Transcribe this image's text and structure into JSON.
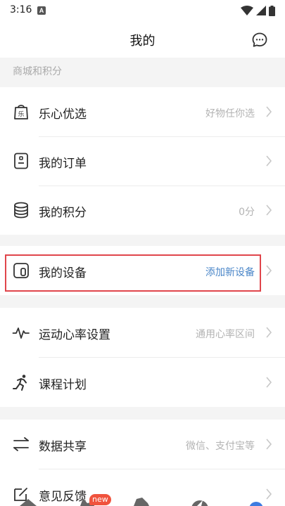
{
  "status": {
    "time": "3:16",
    "a_label": "A"
  },
  "header": {
    "title": "我的"
  },
  "section1": {
    "label": "商城和积分"
  },
  "mall": [
    {
      "label": "乐心优选",
      "value": "好物任你选"
    },
    {
      "label": "我的订单",
      "value": ""
    },
    {
      "label": "我的积分",
      "value": "0分"
    }
  ],
  "device": {
    "label": "我的设备",
    "value": "添加新设备"
  },
  "sport": [
    {
      "label": "运动心率设置",
      "value": "通用心率区间"
    },
    {
      "label": "课程计划",
      "value": ""
    }
  ],
  "share": {
    "label": "数据共享",
    "value": "微信、支付宝等"
  },
  "feedback": {
    "label": "意见反馈"
  },
  "tabbar": {
    "new_badge": "new"
  },
  "colors": {
    "accent_blue": "#4a86c8",
    "highlight_red": "#e0454b",
    "badge_red": "#f0533d"
  }
}
